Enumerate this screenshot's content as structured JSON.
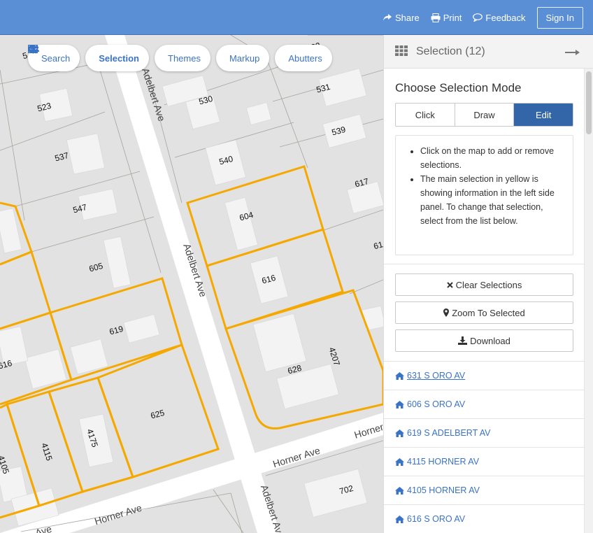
{
  "header": {
    "share_label": "Share",
    "print_label": "Print",
    "feedback_label": "Feedback",
    "signin_label": "Sign In"
  },
  "map_tools": {
    "search_label": "Search",
    "selection_label": "Selection",
    "themes_label": "Themes",
    "markup_label": "Markup",
    "abutters_label": "Abutters"
  },
  "map": {
    "streets": [
      "Adelbert Ave",
      "Adelbert Ave",
      "Adelbert Ave",
      "Horner Ave",
      "Horner Ave",
      "Horner Ave",
      "Ave"
    ],
    "lots": [
      "523",
      "531",
      "539",
      "530",
      "540",
      "523",
      "537",
      "547",
      "605",
      "604",
      "617",
      "616",
      "619",
      "616",
      "628",
      "4207",
      "625",
      "4175",
      "4115",
      "4105",
      "702",
      "61",
      "5"
    ],
    "highlight_color": "#f5a800",
    "street_color": "#ffffff",
    "parcel_color": "#dcdcdc"
  },
  "panel": {
    "title": "Selection (12)",
    "mode_heading": "Choose Selection Mode",
    "modes": [
      "Click",
      "Draw",
      "Edit"
    ],
    "active_mode": "Edit",
    "help": [
      "Click on the map to add or remove selections.",
      "The main selection in yellow is showing information in the left side panel. To change that selection, select from the list below."
    ],
    "clear_label": "Clear Selections",
    "zoom_label": "Zoom To Selected",
    "download_label": "Download",
    "items": [
      "631 S ORO AV",
      "606 S ORO AV",
      "619 S ADELBERT AV",
      "4115 HORNER AV",
      "4105 HORNER AV",
      "616 S ORO AV"
    ],
    "accent_color": "#3366a8"
  }
}
